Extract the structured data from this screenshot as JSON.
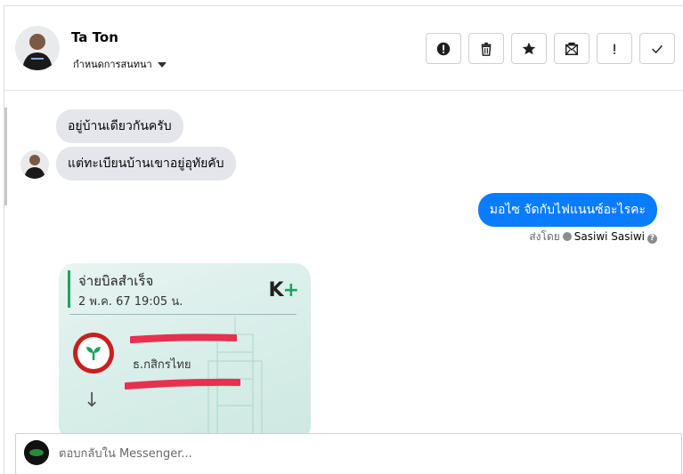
{
  "header": {
    "name": "Ta Ton",
    "subtitle": "กำหนดการสนทนา",
    "actions": [
      {
        "icon": "alert-circle-icon"
      },
      {
        "icon": "trash-icon"
      },
      {
        "icon": "star-icon"
      },
      {
        "icon": "envelope-icon"
      },
      {
        "icon": "exclamation-icon"
      },
      {
        "icon": "checkmark-icon"
      }
    ]
  },
  "messages": {
    "incoming_1": "อยู่บ้านเดียวกันครับ",
    "incoming_2": "แต่ทะเบียนบ้านเขาอยู่อุทัยคับ",
    "outgoing_1": "มอไซ จัดกับไฟแนนซ์อะไรคะ",
    "sent_by_label": "ส่งโดย",
    "sent_by_name": "Sasiwi Sasiwi"
  },
  "receipt": {
    "title": "จ่ายบิลสำเร็จ",
    "date": "2 พ.ค. 67  19:05 น.",
    "logo_k": "K",
    "logo_plus": "+",
    "bank": "ธ.กสิกรไทย",
    "arrow": "↓"
  },
  "composer": {
    "placeholder": "ตอบกลับใน Messenger..."
  },
  "colors": {
    "accent": "#0a7cff",
    "incoming_bubble": "#e4e6eb",
    "kbank_green": "#1ba45d",
    "redact": "#e8304f"
  }
}
